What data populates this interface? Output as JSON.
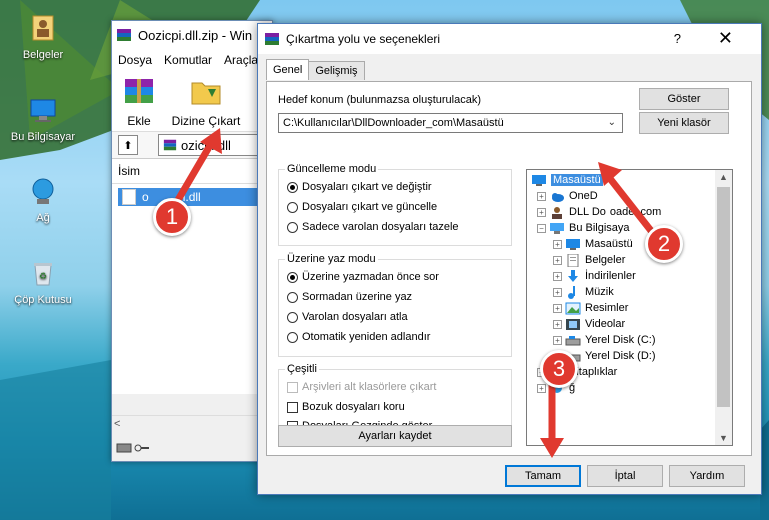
{
  "desktop": {
    "icons": [
      {
        "label": "Belgeler"
      },
      {
        "label": "Bu Bilgisayar"
      },
      {
        "label": "Ağ"
      },
      {
        "label": "Çöp Kutusu"
      }
    ]
  },
  "winrar": {
    "title": "Oozicpi.dll.zip - Win",
    "menu": [
      "Dosya",
      "Komutlar",
      "Araçla"
    ],
    "tools": {
      "add": "Ekle",
      "extract": "Dizine Çıkart"
    },
    "path": "ozicpi.dll",
    "column_name": "İsim",
    "file": "o",
    "file_suffix": "i.dll"
  },
  "dialog": {
    "title": "Çıkartma yolu ve seçenekleri",
    "help": "?",
    "close": "✕",
    "tabs": [
      "Genel",
      "Gelişmiş"
    ],
    "dest_label": "Hedef konum (bulunmazsa oluşturulacak)",
    "dest_value": "C:\\Kullanıcılar\\DllDownloader_com\\Masaüstü",
    "show_button": "Göster",
    "new_folder_button": "Yeni klasör",
    "update_group": {
      "title": "Güncelleme modu",
      "options": [
        "Dosyaları çıkart ve değiştir",
        "Dosyaları çıkart ve güncelle",
        "Sadece varolan dosyaları tazele"
      ],
      "selected": 0
    },
    "overwrite_group": {
      "title": "Üzerine yaz modu",
      "options": [
        "Üzerine yazmadan önce sor",
        "Sormadan üzerine yaz",
        "Varolan dosyaları atla",
        "Otomatik yeniden adlandır"
      ],
      "selected": 0
    },
    "misc_group": {
      "title": "Çeşitli",
      "options": [
        "Arşivleri alt klasörlere çıkart",
        "Bozuk dosyaları koru",
        "Dosyaları Gezginde göster"
      ]
    },
    "save_settings": "Ayarları kaydet",
    "tree": [
      {
        "label": "Masaüstü"
      },
      {
        "label": "OneD"
      },
      {
        "label": "DLL Do",
        "tail": "oader.com"
      },
      {
        "label": "Bu Bilgisaya"
      },
      {
        "label": "Masaüstü"
      },
      {
        "label": "Belgeler"
      },
      {
        "label": "İndirilenler"
      },
      {
        "label": "Müzik"
      },
      {
        "label": "Resimler"
      },
      {
        "label": "Videolar"
      },
      {
        "label": "Yerel Disk (C:)"
      },
      {
        "label": "Yerel Disk (D:)"
      },
      {
        "label": "Kitaplıklar"
      },
      {
        "label": "ğ"
      }
    ],
    "ok": "Tamam",
    "cancel": "İptal",
    "help_button": "Yardım"
  },
  "annotations": [
    "1",
    "2",
    "3"
  ],
  "colors": {
    "accent": "#0078d7",
    "selection": "#3d8ee0",
    "badge": "#e0392f"
  }
}
